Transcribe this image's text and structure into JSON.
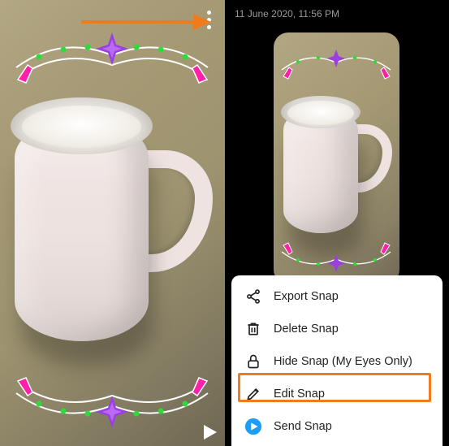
{
  "timestamp": "11 June 2020, 11:56 PM",
  "menu": {
    "export": {
      "label": "Export Snap",
      "icon": "share-icon"
    },
    "delete": {
      "label": "Delete Snap",
      "icon": "trash-icon"
    },
    "hide": {
      "label": "Hide Snap (My Eyes Only)",
      "icon": "lock-icon"
    },
    "edit": {
      "label": "Edit Snap",
      "icon": "pencil-icon"
    },
    "send": {
      "label": "Send Snap",
      "icon": "send-icon"
    }
  },
  "annotation": {
    "points_to": "more-options-icon",
    "highlights": "edit-snap-row"
  },
  "colors": {
    "annotation": "#ef7b1a",
    "send_icon": "#1e9df7"
  }
}
